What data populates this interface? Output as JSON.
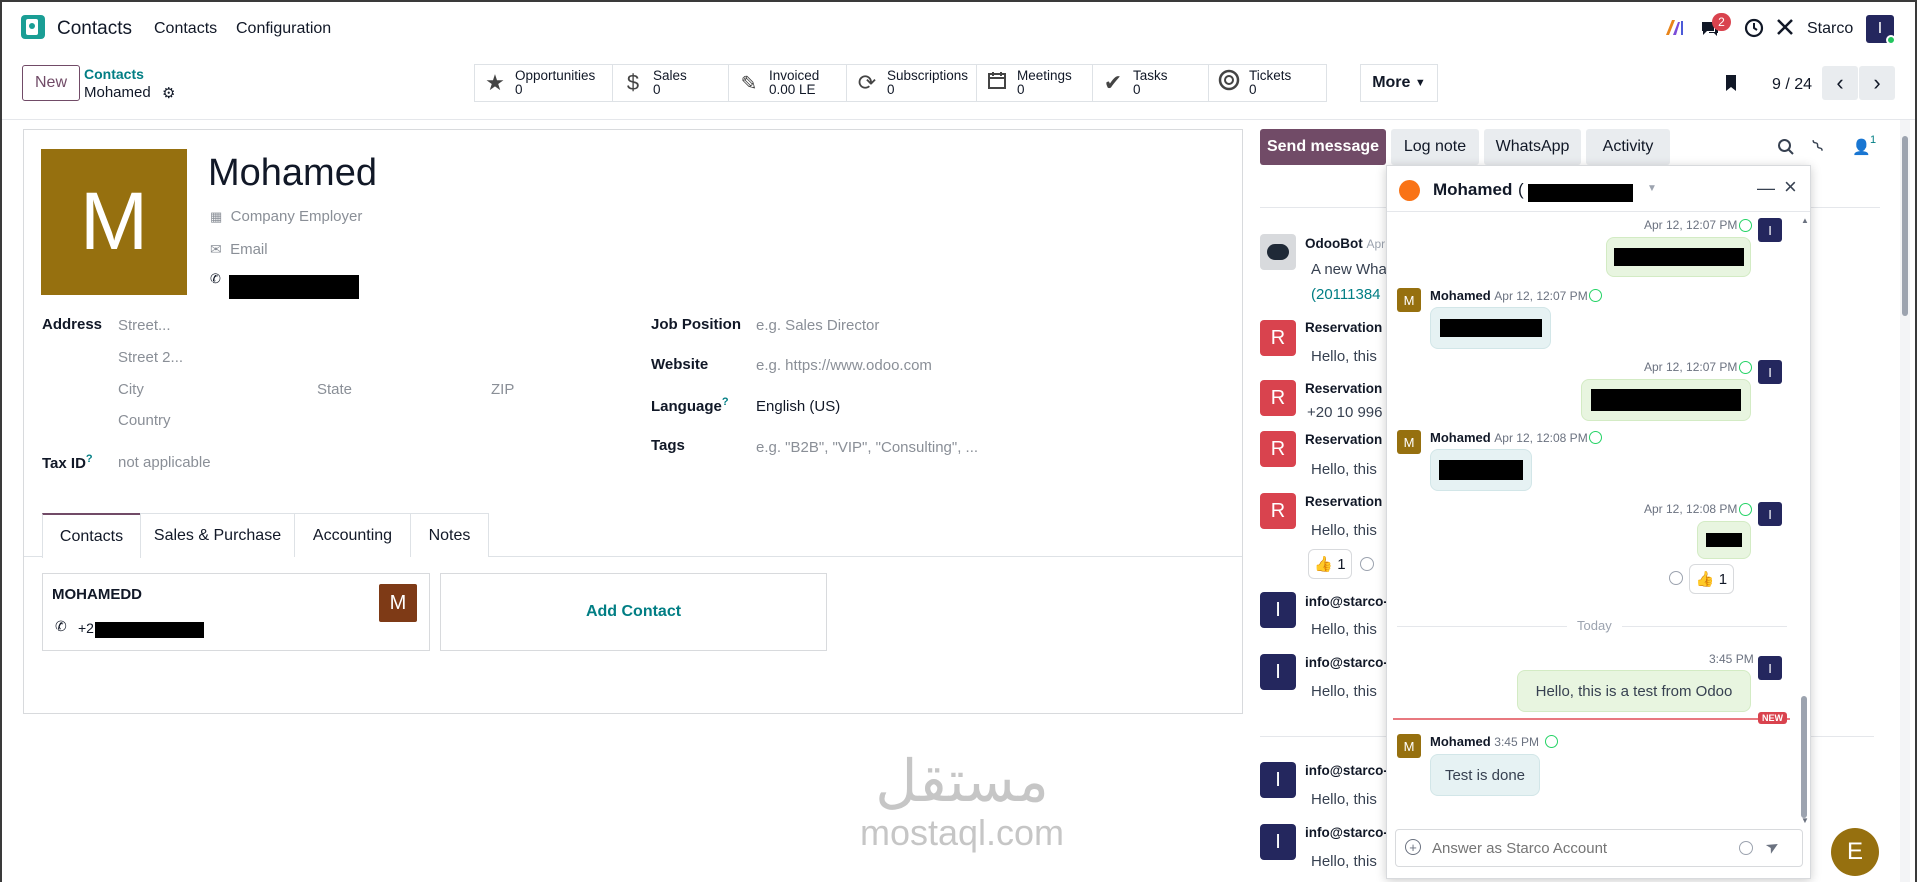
{
  "app": {
    "name": "Contacts",
    "menu": [
      "Contacts",
      "Configuration"
    ],
    "company": "Starco",
    "user_initial": "I",
    "notification_count": "2"
  },
  "control": {
    "new_label": "New",
    "breadcrumb_parent": "Contacts",
    "breadcrumb_current": "Mohamed",
    "smart_buttons": [
      {
        "label": "Opportunities",
        "value": "0"
      },
      {
        "label": "Sales",
        "value": "0"
      },
      {
        "label": "Invoiced",
        "value": "0.00 LE"
      },
      {
        "label": "Subscriptions",
        "value": "0"
      },
      {
        "label": "Meetings",
        "value": "0"
      },
      {
        "label": "Tasks",
        "value": "0"
      },
      {
        "label": "Tickets",
        "value": "0"
      }
    ],
    "more_label": "More",
    "pager": "9 / 24"
  },
  "form": {
    "avatar_initial": "M",
    "name": "Mohamed",
    "company_placeholder": "Company Employer",
    "email_placeholder": "Email",
    "address_label": "Address",
    "street_placeholder": "Street...",
    "street2_placeholder": "Street 2...",
    "city_placeholder": "City",
    "state_placeholder": "State",
    "zip_placeholder": "ZIP",
    "country_placeholder": "Country",
    "taxid_label": "Tax ID",
    "taxid_value": "not applicable",
    "job_label": "Job Position",
    "job_placeholder": "e.g. Sales Director",
    "website_label": "Website",
    "website_placeholder": "e.g. https://www.odoo.com",
    "language_label": "Language",
    "language_value": "English (US)",
    "tags_label": "Tags",
    "tags_placeholder": "e.g. \"B2B\", \"VIP\", \"Consulting\", ...",
    "help_mark": "?",
    "tabs": [
      "Contacts",
      "Sales & Purchase",
      "Accounting",
      "Notes"
    ],
    "contact_card": {
      "name": "MOHAMEDD",
      "avatar": "M",
      "phone_prefix": "+2"
    },
    "add_contact_label": "Add Contact"
  },
  "chatter": {
    "buttons": [
      "Send message",
      "Log note",
      "WhatsApp",
      "Activity"
    ],
    "follower_count": "1",
    "messages": [
      {
        "initial": "",
        "author": "OdooBot",
        "meta": "Apr",
        "body": "A new Wha",
        "body2": "(20111384"
      },
      {
        "initial": "R",
        "author": "Reservation",
        "body": "Hello, this"
      },
      {
        "initial": "R",
        "author": "Reservation",
        "body": "+20 10 996"
      },
      {
        "initial": "R",
        "author": "Reservation",
        "body": "Hello, this"
      },
      {
        "initial": "R",
        "author": "Reservation",
        "body": "Hello, this"
      },
      {
        "initial": "I",
        "author": "info@starco-",
        "body": "Hello, this"
      },
      {
        "initial": "I",
        "author": "info@starco-",
        "body": "Hello, this"
      },
      {
        "initial": "I",
        "author": "info@starco-",
        "body": "Hello, this"
      },
      {
        "initial": "I",
        "author": "info@starco-",
        "body": "Hello, this"
      }
    ],
    "reaction": "👍 1"
  },
  "chat": {
    "title": "Mohamed",
    "title_paren": "(",
    "author": "Mohamed",
    "self_initial": "I",
    "partner_initial": "M",
    "times": [
      "Apr 12, 12:07 PM",
      "Apr 12, 12:07 PM",
      "Apr 12, 12:07 PM",
      "Apr 12, 12:08 PM",
      "Apr 12, 12:08 PM",
      "3:45 PM",
      "3:45 PM"
    ],
    "reaction": "👍 1",
    "today_label": "Today",
    "new_badge": "NEW",
    "test_message": "Hello, this is a test from Odoo",
    "reply_message": "Test is done",
    "compose_placeholder": "Answer as Starco Account"
  },
  "fab_initial": "E",
  "watermark": {
    "arabic": "مستقل",
    "latin": "mostaql.com"
  },
  "colors": {
    "primary": "#714b67",
    "teal": "#017e84",
    "avatar_brown": "#96700f",
    "avatar_red": "#d9434e",
    "avatar_navy": "#24275e"
  }
}
